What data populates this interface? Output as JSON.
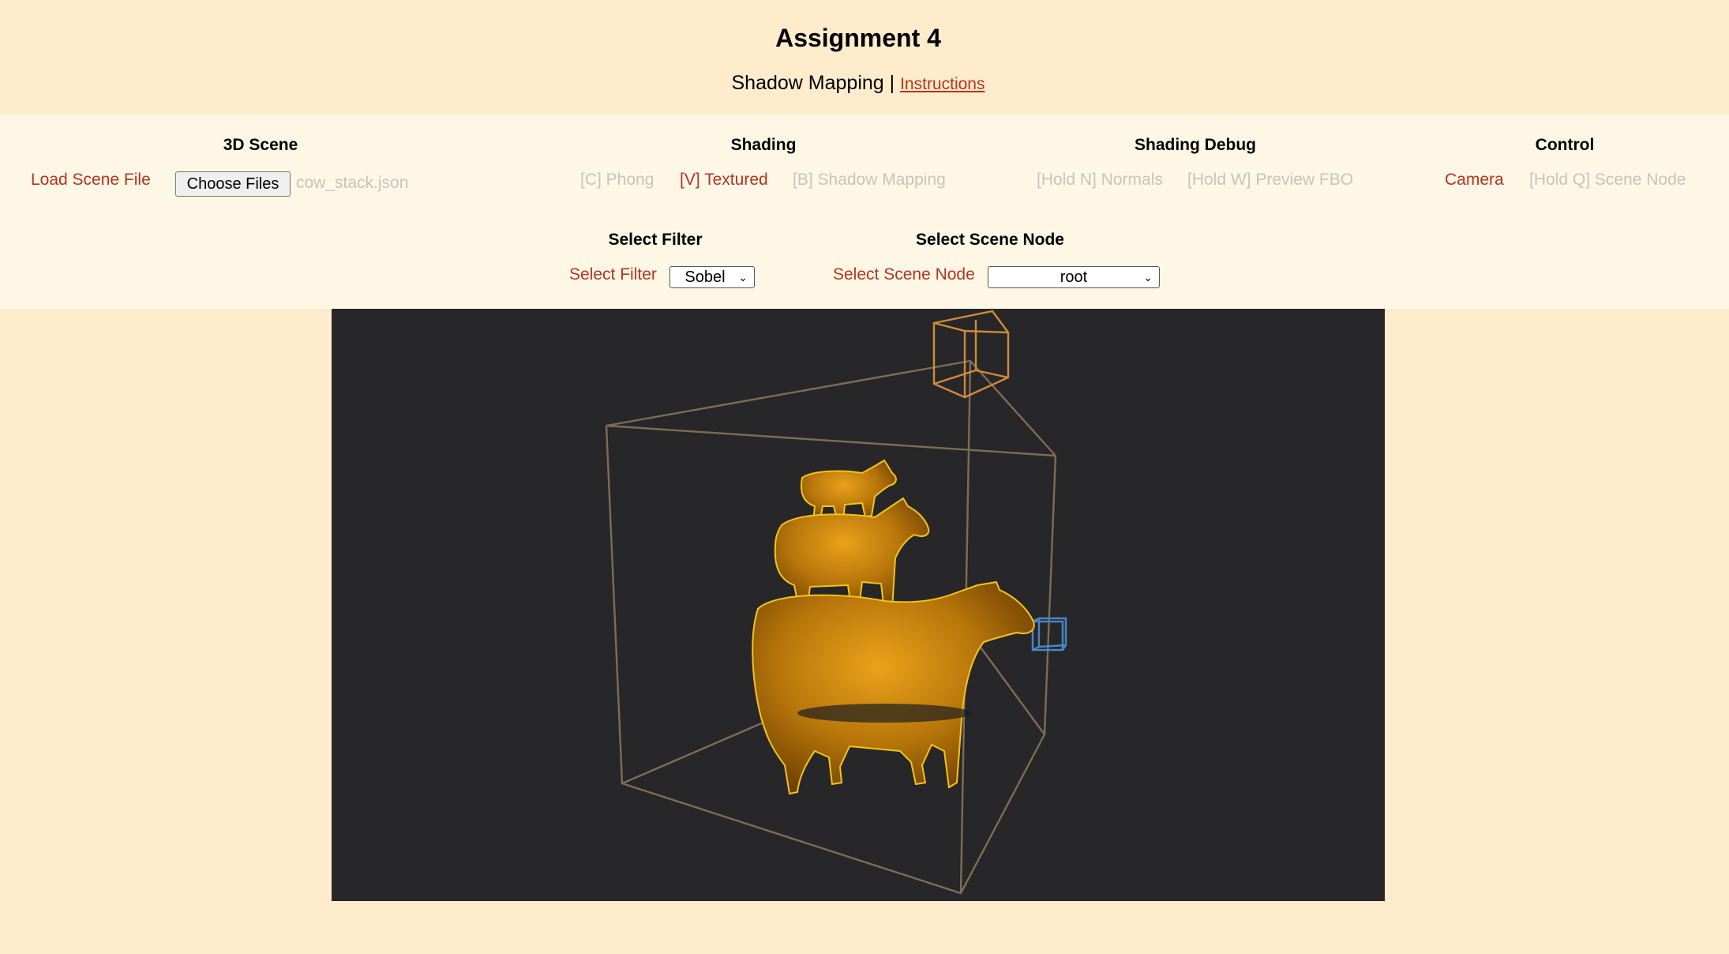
{
  "header": {
    "title": "Assignment 4",
    "subtitle": "Shadow Mapping |",
    "instructions_link": "Instructions"
  },
  "sections": {
    "scene": {
      "heading": "3D Scene",
      "load_label": "Load Scene File",
      "choose_button": "Choose Files",
      "file_name": "cow_stack.json"
    },
    "shading": {
      "heading": "Shading",
      "phong": "[C] Phong",
      "textured": "[V] Textured",
      "shadow": "[B] Shadow Mapping"
    },
    "shading_debug": {
      "heading": "Shading Debug",
      "normals": "[Hold N] Normals",
      "preview_fbo": "[Hold W] Preview FBO"
    },
    "control": {
      "heading": "Control",
      "camera": "Camera",
      "scene_node": "[Hold Q] Scene Node"
    },
    "filter": {
      "heading": "Select Filter",
      "label": "Select Filter",
      "value": "Sobel"
    },
    "scene_node": {
      "heading": "Select Scene Node",
      "label": "Select Scene Node",
      "value": "root"
    }
  },
  "colors": {
    "active": "#b5341d",
    "inactive": "#c8c3bb",
    "header_bg": "#ffeccc",
    "controls_bg": "#fff7e6",
    "viewport_bg": "#272729",
    "bbox": "#8c7a5a",
    "light_box": "#d18a3a",
    "camera_box": "#4a86c8",
    "cow": "#c9870b"
  },
  "icons": {
    "select_chevron": "chevron-down-icon",
    "light_marker": "light-cube-icon",
    "camera_marker": "camera-cube-icon"
  }
}
